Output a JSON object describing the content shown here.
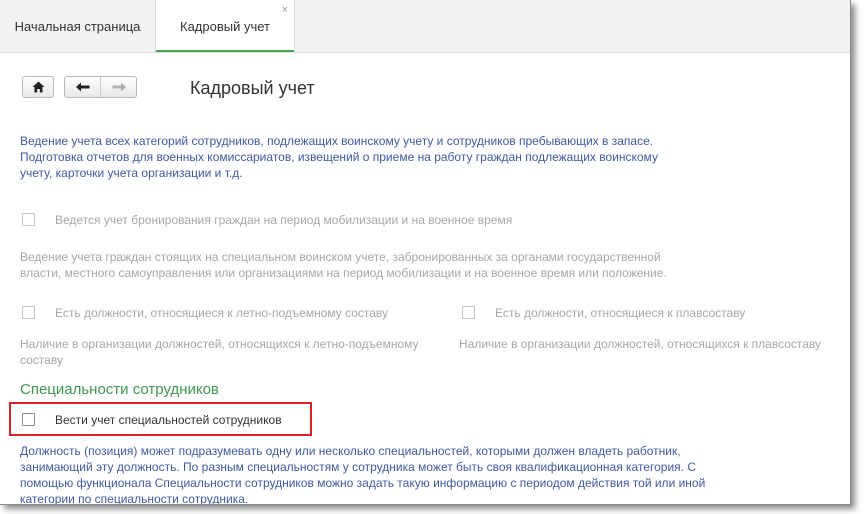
{
  "tabs": [
    {
      "label": "Начальная страница"
    },
    {
      "label": "Кадровый учет",
      "close": "×"
    }
  ],
  "page": {
    "title": "Кадровый учет"
  },
  "intro_text": [
    "Ведение учета всех категорий сотрудников, подлежащих воинскому учету и сотрудников пребывающих в запасе.",
    "Подготовка отчетов для военных комиссариатов, извещений о приеме на работу граждан подлежащих воинскому",
    "учету, карточки учета организации и т.д."
  ],
  "reservation": {
    "checkbox_label": "Ведется учет бронирования граждан на период мобилизации и на военное время",
    "checked": false,
    "description": [
      "Ведение учета граждан стоящих на специальном воинском учете, забронированных за органами государственной",
      "власти, местного самоуправления или организациями на период мобилизации и на военное время или положение."
    ]
  },
  "flight_crew": {
    "checkbox_label": "Есть должности, относящиеся к летно-подъемному составу",
    "checked": false,
    "description": [
      "Наличие в организации должностей, относящихся к летно-подъемному",
      "составу"
    ]
  },
  "sea_crew": {
    "checkbox_label": "Есть должности, относящиеся к плавсоставу",
    "checked": false,
    "description": [
      "Наличие в организации должностей, относящихся к плавсоставу"
    ]
  },
  "specialties": {
    "section_title": "Специальности сотрудников",
    "checkbox_label": "Вести учет специальностей сотрудников",
    "checked": false,
    "description": [
      "Должность (позиция) может подразумевать одну или несколько специальностей, которыми должен владеть работник,",
      "занимающий эту должность. По разным специальностям у сотрудника может быть своя квалификационная категория. С",
      "помощью функционала Специальности сотрудников можно задать такую информацию с периодом действия той или иной",
      "категории по специальности сотрудника."
    ]
  },
  "colors": {
    "link_blue": "#3c5aa7",
    "section_green": "#3c9a4d",
    "disabled_gray": "#a7a7a7",
    "highlight_red": "#e02020",
    "active_tab_underline": "#44a853"
  },
  "icons": [
    "home-icon",
    "back-arrow-icon",
    "forward-arrow-icon",
    "close-icon"
  ]
}
